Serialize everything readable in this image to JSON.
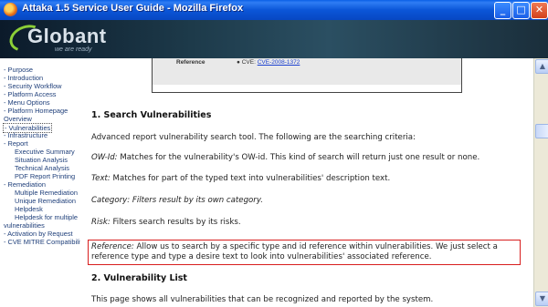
{
  "window": {
    "title": "Attaka 1.5 Service User Guide - Mozilla Firefox",
    "buttons": {
      "minimize": "_",
      "maximize": "□",
      "close": "✕"
    }
  },
  "banner": {
    "logo_text": "Globant",
    "tagline": "we are ready"
  },
  "nav": {
    "items": [
      {
        "label": "- Purpose",
        "sub": false
      },
      {
        "label": "- Introduction",
        "sub": false
      },
      {
        "label": "- Security Workflow",
        "sub": false
      },
      {
        "label": "- Platform Access",
        "sub": false
      },
      {
        "label": "- Menu Options",
        "sub": false
      },
      {
        "label": "- Platform Homepage",
        "sub": false
      },
      {
        "label": "Overview",
        "sub": false
      },
      {
        "label": "- Vulnerabilities",
        "sub": false,
        "selected": true
      },
      {
        "label": "- Infrastructure",
        "sub": false
      },
      {
        "label": "- Report",
        "sub": false
      },
      {
        "label": "Executive Summary",
        "sub": true
      },
      {
        "label": "Situation Analysis",
        "sub": true
      },
      {
        "label": "Technical Analysis",
        "sub": true
      },
      {
        "label": "PDF Report Printing",
        "sub": true
      },
      {
        "label": "- Remediation",
        "sub": false
      },
      {
        "label": "Multiple Remediation",
        "sub": true
      },
      {
        "label": "Unique Remediation",
        "sub": true
      },
      {
        "label": "Helpdesk",
        "sub": true
      },
      {
        "label": "Helpdesk for multiple",
        "sub": true
      },
      {
        "label": "vulnerabilities",
        "sub": false
      },
      {
        "label": "- Activation by Request",
        "sub": false
      },
      {
        "label": "- CVE MITRE Compatibility",
        "sub": false
      }
    ]
  },
  "content": {
    "screenshot": {
      "label": "Reference",
      "bullet_prefix": "CVE:",
      "link": "CVE-2008-1372"
    },
    "section1_title": "1. Search Vulnerabilities",
    "intro": "Advanced report vulnerability search tool. The following are the searching criteria:",
    "criteria": [
      {
        "term": "OW-Id:",
        "text": " Matches for the vulnerability's OW-id. This kind of search will return just one result or none."
      },
      {
        "term": "Text:",
        "text": " Matches for part of the typed text into vulnerabilities' description text."
      },
      {
        "term": "Category: Filters result by its own category.",
        "text": ""
      },
      {
        "term": "Risk:",
        "text": " Filters search results by its risks."
      }
    ],
    "reference": {
      "term": "Reference:",
      "line1": " Allow us to search by a specific type and id reference within vulnerabilities. We just select a",
      "line2": "reference type and type a desire text to look into vulnerabilities' associated reference."
    },
    "section2_title": "2. Vulnerability List",
    "section2_text": "This page shows all vulnerabilities that can be recognized and reported by the system."
  }
}
